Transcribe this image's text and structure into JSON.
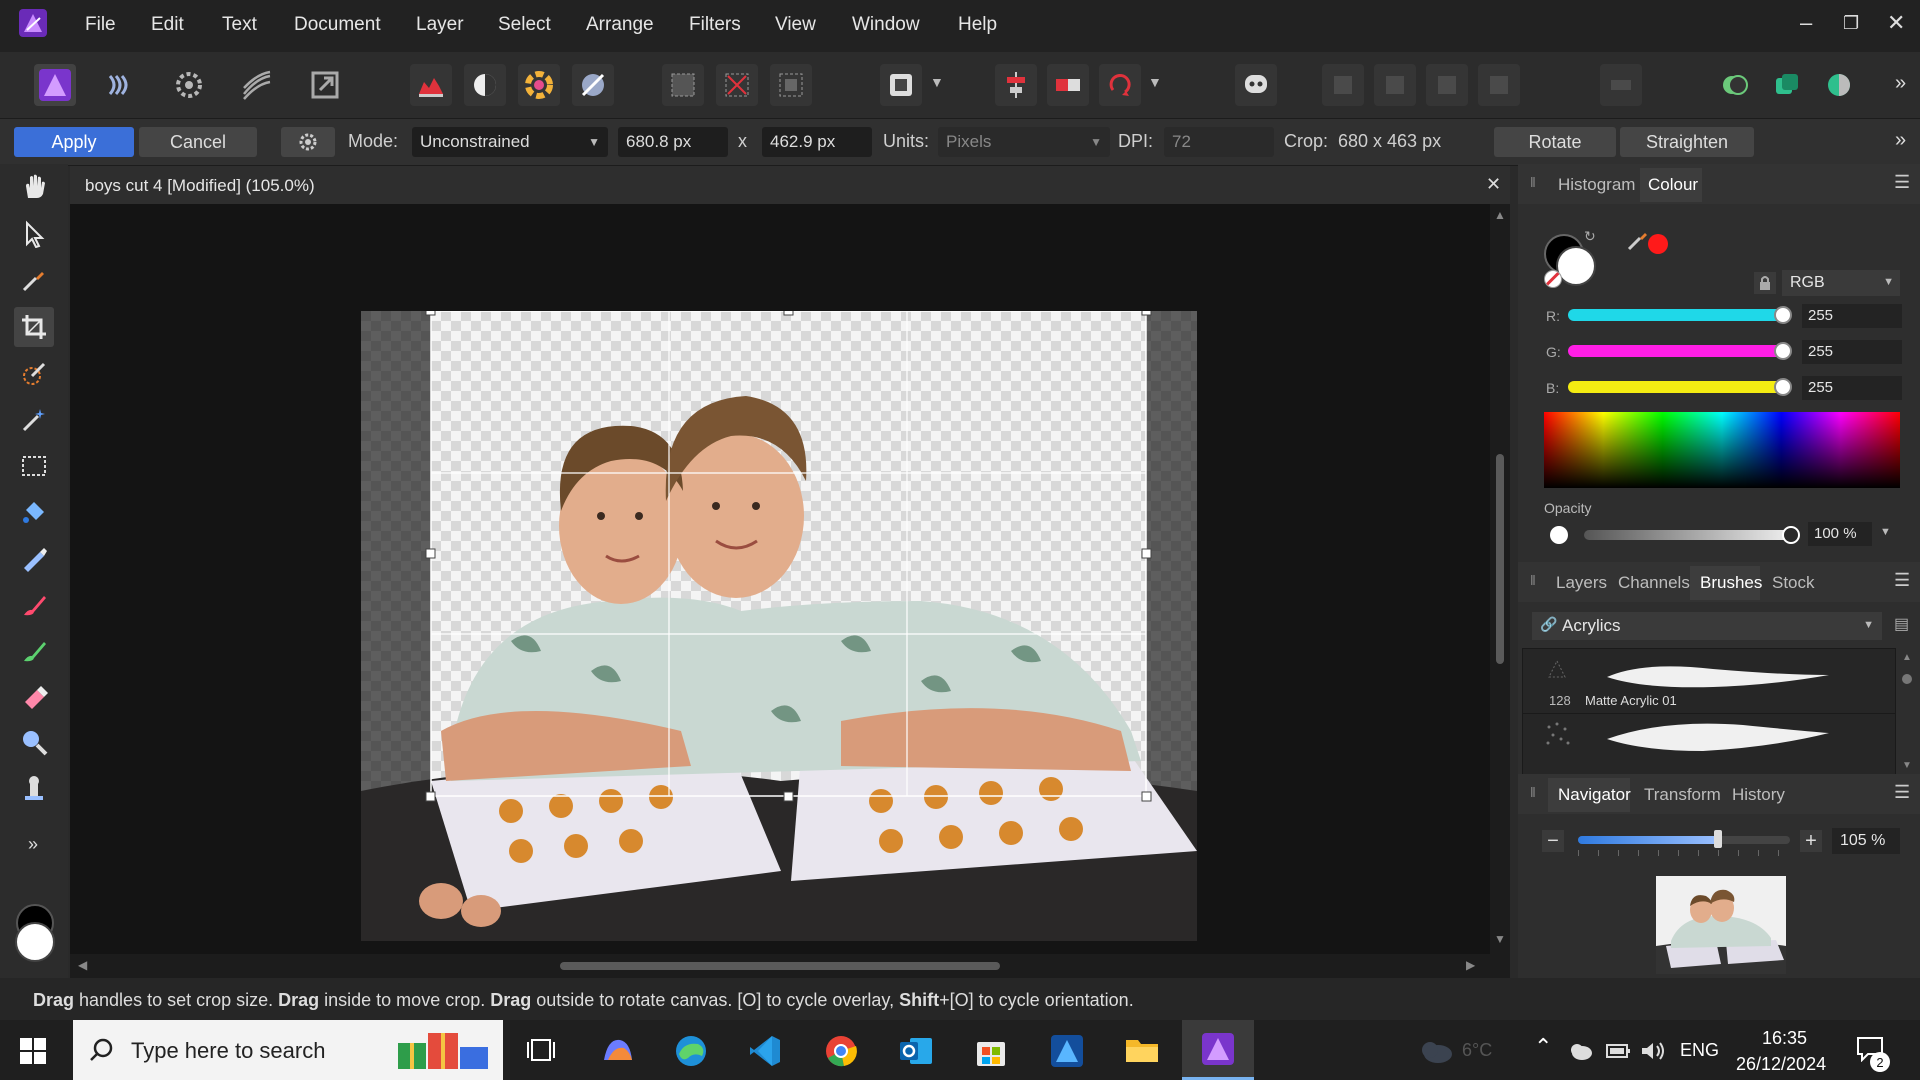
{
  "menubar": {
    "items": [
      "File",
      "Edit",
      "Text",
      "Document",
      "Layer",
      "Select",
      "Arrange",
      "Filters",
      "View",
      "Window",
      "Help"
    ]
  },
  "context": {
    "apply": "Apply",
    "cancel": "Cancel",
    "mode_label": "Mode:",
    "mode_value": "Unconstrained",
    "width": "680.8 px",
    "x": "x",
    "height": "462.9 px",
    "units_label": "Units:",
    "units_value": "Pixels",
    "dpi_label": "DPI:",
    "dpi_value": "72",
    "crop_label": "Crop:",
    "crop_value": "680 x 463 px",
    "rotate": "Rotate",
    "straighten": "Straighten"
  },
  "document": {
    "title": "boys cut 4 [Modified] (105.0%)"
  },
  "colour_panel": {
    "tabs": [
      "Histogram",
      "Colour"
    ],
    "active_tab": "Colour",
    "model": "RGB",
    "r_label": "R:",
    "r": "255",
    "g_label": "G:",
    "g": "255",
    "b_label": "B:",
    "b": "255",
    "opacity_label": "Opacity",
    "opacity": "100 %"
  },
  "brushes_panel": {
    "tabs": [
      "Layers",
      "Channels",
      "Brushes",
      "Stock"
    ],
    "active_tab": "Brushes",
    "category": "Acrylics",
    "brushes": [
      {
        "size": "128",
        "name": "Matte Acrylic 01"
      }
    ]
  },
  "navigator_panel": {
    "tabs": [
      "Navigator",
      "Transform",
      "History"
    ],
    "active_tab": "Navigator",
    "zoom": "105 %",
    "zoom_fraction": 0.66
  },
  "status": {
    "parts": [
      {
        "b": "Drag",
        "t": " handles to set crop size. "
      },
      {
        "b": "Drag",
        "t": " inside to move crop. "
      },
      {
        "b": "Drag",
        "t": " outside to rotate canvas. [O] to cycle overlay, "
      },
      {
        "b": "Shift",
        "t": "+[O] to cycle orientation."
      }
    ]
  },
  "taskbar": {
    "search_placeholder": "Type here to search",
    "weather": "6°C",
    "lang": "ENG",
    "time": "16:35",
    "date": "26/12/2024",
    "notifications": "2"
  },
  "colors": {
    "accent": "#3b6fd8",
    "r_slider": "#1fd8e8",
    "g_slider": "#ff1ee6",
    "b_slider": "#f4ec12",
    "affinity": "#8e39e0"
  }
}
